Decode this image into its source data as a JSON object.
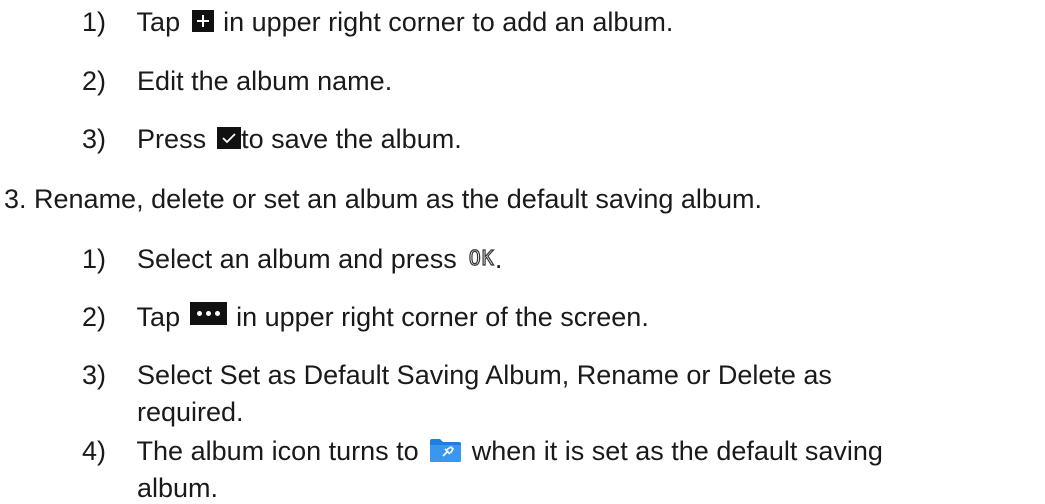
{
  "steps_a": [
    {
      "num": "1)",
      "pre": "Tap",
      "post": "in upper right corner to add an album."
    },
    {
      "num": "2)",
      "text": "Edit the album name."
    },
    {
      "num": "3)",
      "pre": "Press",
      "post": "to save the album."
    }
  ],
  "section_3": {
    "text": "3. Rename, delete or set an album as the default saving album."
  },
  "steps_b": [
    {
      "num": "1)",
      "pre": "Select an album and press",
      "icon_text": "OK",
      "post": "."
    },
    {
      "num": "2)",
      "pre": "Tap",
      "post": "in upper right corner of the screen."
    },
    {
      "num": "3)",
      "line1": "Select Set as Default Saving Album, Rename or Delete as",
      "line2": "required."
    },
    {
      "num": "4)",
      "pre": "The album icon turns to",
      "post": "when it is set as the default saving",
      "line2": "album."
    }
  ],
  "icons": {
    "add": "plus-icon",
    "save": "check-icon",
    "ok_key": "ok-icon",
    "more": "more-icon",
    "default_album": "folder-pin-icon"
  },
  "colors": {
    "text": "#1a1a1a",
    "icon_bg": "#111111",
    "folder_blue": "#1e7fe0"
  }
}
